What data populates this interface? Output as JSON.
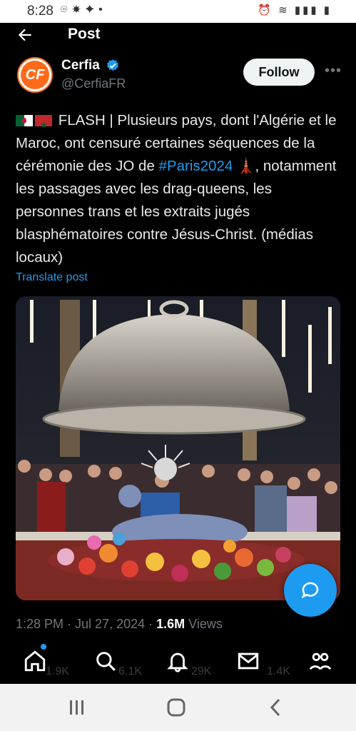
{
  "status_bar": {
    "time": "8:28"
  },
  "header": {
    "title": "Post"
  },
  "author": {
    "name": "Cerfia",
    "handle": "@CerfiaFR",
    "avatar_text": "CF",
    "follow_label": "Follow"
  },
  "tweet": {
    "text_part1": "FLASH | Plusieurs pays, dont l'Algérie et le Maroc, ont censuré certaines séquences de la cérémonie des JO de ",
    "hashtag": "#Paris2024",
    "text_part2": " 🗼, notamment les passages avec les drag-queens, les personnes trans et les extraits jugés blasphématoires contre Jésus-Christ. (médias locaux)",
    "translate_label": "Translate post"
  },
  "meta": {
    "timestamp": "1:28 PM · Jul 27, 2024 · ",
    "views_count": "1.6M",
    "views_label": " Views"
  },
  "stats": {
    "replies": "1.9K",
    "reposts": "6.1K",
    "likes": "29K",
    "bookmarks": "1.4K"
  },
  "colors": {
    "accent": "#1d9bf0",
    "background": "#000000",
    "brand_orange": "#ff6a1a"
  }
}
